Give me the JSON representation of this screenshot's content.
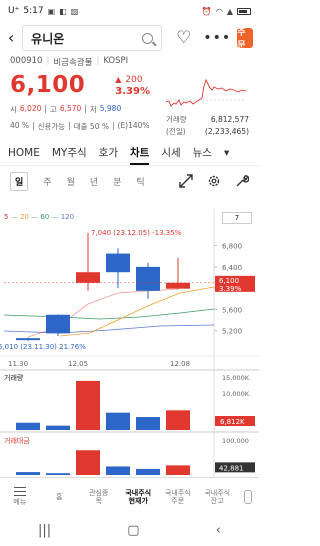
{
  "status_bar": {
    "carrier": "U⁺",
    "time": "5:17",
    "left_icons": [
      "message-icon",
      "app-icon",
      "gallery-icon"
    ],
    "right_icons": [
      "alarm-icon",
      "wifi-icon",
      "signal-icon",
      "battery-icon"
    ]
  },
  "header": {
    "stock_name": "유니온",
    "order_label": "주문"
  },
  "stock": {
    "code": "000910",
    "sector": "비금속광물",
    "market": "KOSPI",
    "price": "6,100",
    "change": "200",
    "change_pct": "3.39%",
    "start_label": "시",
    "start": "6,020",
    "high_label": "고",
    "high": "6,570",
    "low_label": "저",
    "low": "5,980",
    "margin_rate": "40 %",
    "credit_label": "신용가능",
    "loan_label": "대출 50 %",
    "e_label": "(E)140%",
    "volume_label": "거래량",
    "prev_label": "(전일)",
    "volume": "6,812,577",
    "prev_volume": "(2,233,465)"
  },
  "tabs": [
    "HOME",
    "MY주식",
    "호가",
    "차트",
    "시세",
    "뉴스"
  ],
  "active_tab": "차트",
  "periods": [
    "일",
    "주",
    "월",
    "년",
    "분",
    "틱"
  ],
  "active_period": "일",
  "chart_ui": {
    "ma_legend": [
      "5",
      "20",
      "60",
      "120"
    ],
    "ma_colors": [
      "#e0382f",
      "#f0a030",
      "#3a9a6a",
      "#5a7ad0"
    ],
    "period_select": "7",
    "y_ticks": [
      "6,800",
      "6,400",
      "6,000",
      "5,600",
      "5,200"
    ],
    "current_tag_price": "6,100",
    "current_tag_pct": "3.39%",
    "high_annot": "7,040 (23.12.05) -13.35%",
    "low_annot": "5,010 (23.11.30) 21.76%",
    "x_labels": [
      "11.30",
      "12.05",
      "12.08"
    ],
    "volume_title": "거래량",
    "volume_tick": "15,000K",
    "volume_tick2": "10,000K",
    "volume_current": "6,812K",
    "trade_amount_title": "거래대금",
    "trade_amount_tick": "100,000",
    "trade_amount_current": "42,881"
  },
  "chart_data": {
    "type": "candlestick",
    "candles": [
      {
        "open": 5040,
        "close": 5060,
        "high": 5070,
        "low": 5010,
        "dir": "down"
      },
      {
        "open": 5150,
        "close": 5500,
        "high": 5510,
        "low": 5100,
        "dir": "down"
      },
      {
        "open": 6100,
        "close": 6300,
        "high": 7040,
        "low": 5950,
        "dir": "up"
      },
      {
        "open": 6650,
        "close": 6300,
        "high": 6750,
        "low": 6000,
        "dir": "down"
      },
      {
        "open": 6400,
        "close": 5950,
        "high": 6480,
        "low": 5800,
        "dir": "down"
      },
      {
        "open": 5990,
        "close": 6100,
        "high": 6570,
        "low": 5980,
        "dir": "up"
      }
    ],
    "volume": [
      {
        "value": 2500,
        "dir": "down"
      },
      {
        "value": 1500,
        "dir": "down"
      },
      {
        "value": 17000,
        "dir": "up"
      },
      {
        "value": 6000,
        "dir": "down"
      },
      {
        "value": 4500,
        "dir": "down"
      },
      {
        "value": 6812,
        "dir": "up"
      }
    ],
    "trade_amount": [
      {
        "value": 13000,
        "dir": "down"
      },
      {
        "value": 8000,
        "dir": "down"
      },
      {
        "value": 110000,
        "dir": "up"
      },
      {
        "value": 38000,
        "dir": "down"
      },
      {
        "value": 27000,
        "dir": "down"
      },
      {
        "value": 42881,
        "dir": "up"
      }
    ],
    "price_range": [
      4950,
      7150
    ],
    "volume_range": [
      0,
      18000
    ],
    "trade_amount_range": [
      0,
      120000
    ]
  },
  "bottom_nav": [
    {
      "label": "메뉴"
    },
    {
      "label": "홈"
    },
    {
      "label": "관심종목"
    },
    {
      "label": "국내주식현재가",
      "active": true
    },
    {
      "label": "국내주식주문"
    },
    {
      "label": "국내주식잔고"
    }
  ],
  "colors": {
    "up": "#e0382f",
    "down": "#2c66c8",
    "order": "#f0642a"
  }
}
